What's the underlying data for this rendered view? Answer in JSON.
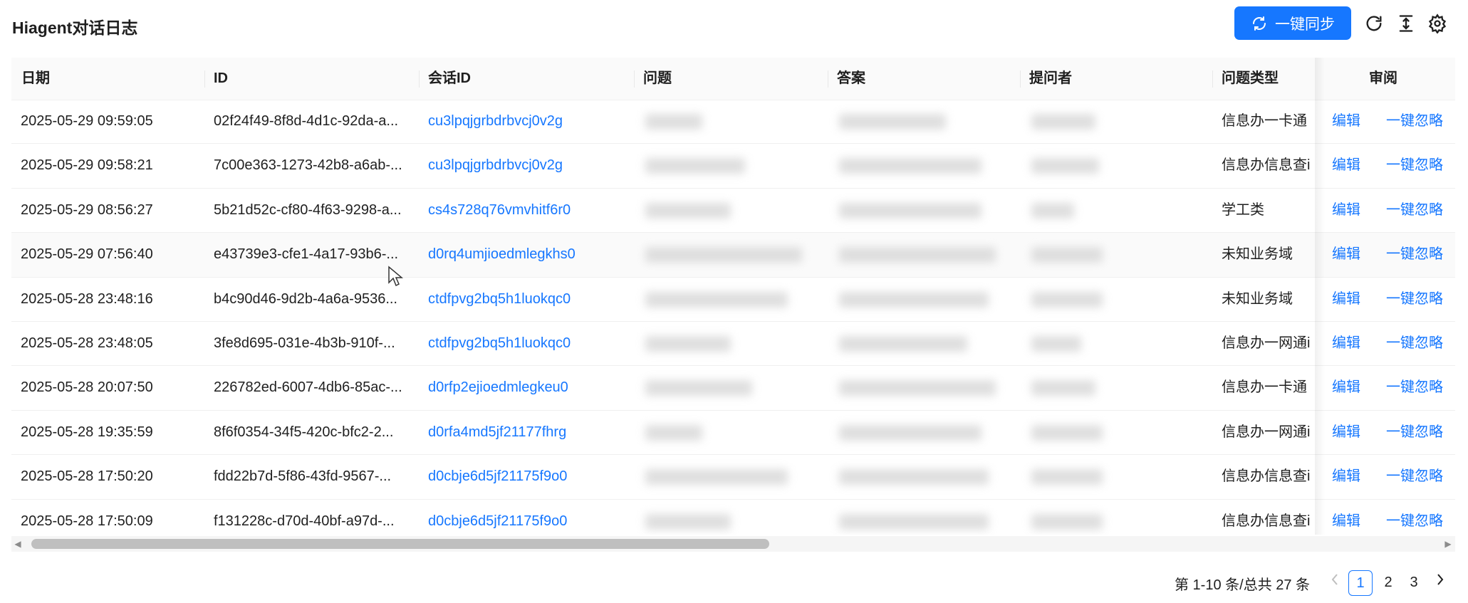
{
  "header": {
    "title": "Hiagent对话日志",
    "sync_label": "一键同步"
  },
  "table": {
    "columns": [
      "日期",
      "ID",
      "会话ID",
      "问题",
      "答案",
      "提问者",
      "问题类型",
      "审阅"
    ],
    "action_edit": "编辑",
    "action_ignore": "一键忽略",
    "rows": [
      {
        "date": "2025-05-29 09:59:05",
        "id": "02f24f49-8f8d-4d1c-92da-a...",
        "session": "cu3lpqjgrbdrbvcj0v2g",
        "type": "信息办一卡通"
      },
      {
        "date": "2025-05-29 09:58:21",
        "id": "7c00e363-1273-42b8-a6ab-...",
        "session": "cu3lpqjgrbdrbvcj0v2g",
        "type": "信息办信息查i"
      },
      {
        "date": "2025-05-29 08:56:27",
        "id": "5b21d52c-cf80-4f63-9298-a...",
        "session": "cs4s728q76vmvhitf6r0",
        "type": "学工类"
      },
      {
        "date": "2025-05-29 07:56:40",
        "id": "e43739e3-cfe1-4a17-93b6-...",
        "session": "d0rq4umjioedmlegkhs0",
        "type": "未知业务域"
      },
      {
        "date": "2025-05-28 23:48:16",
        "id": "b4c90d46-9d2b-4a6a-9536...",
        "session": "ctdfpvg2bq5h1luokqc0",
        "type": "未知业务域"
      },
      {
        "date": "2025-05-28 23:48:05",
        "id": "3fe8d695-031e-4b3b-910f-...",
        "session": "ctdfpvg2bq5h1luokqc0",
        "type": "信息办一网通i"
      },
      {
        "date": "2025-05-28 20:07:50",
        "id": "226782ed-6007-4db6-85ac-...",
        "session": "d0rfp2ejioedmlegkeu0",
        "type": "信息办一卡通"
      },
      {
        "date": "2025-05-28 19:35:59",
        "id": "8f6f0354-34f5-420c-bfc2-2...",
        "session": "d0rfa4md5jf21177fhrg",
        "type": "信息办一网通i"
      },
      {
        "date": "2025-05-28 17:50:20",
        "id": "fdd22b7d-5f86-43fd-9567-...",
        "session": "d0cbje6d5jf21175f9o0",
        "type": "信息办信息查i"
      },
      {
        "date": "2025-05-28 17:50:09",
        "id": "f131228c-d70d-40bf-a97d-...",
        "session": "d0cbje6d5jf21175f9o0",
        "type": "信息办信息查i"
      }
    ]
  },
  "pagination": {
    "total_text": "第 1-10 条/总共 27 条",
    "pages": [
      "1",
      "2",
      "3"
    ],
    "current": "1"
  },
  "colors": {
    "primary": "#1677ff",
    "header_bg": "#fafafa"
  },
  "icons": {
    "sync": "sync-icon",
    "reload": "reload-icon",
    "column_height": "column-height-icon",
    "settings": "setting-icon"
  }
}
